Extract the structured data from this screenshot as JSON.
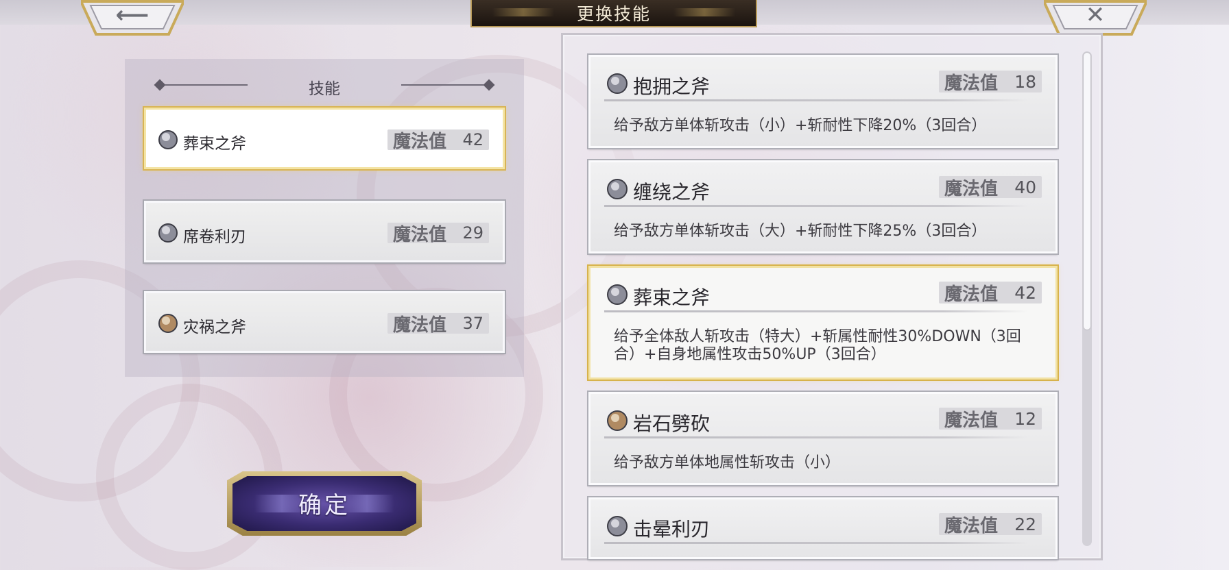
{
  "title": "更换技能",
  "nav": {
    "back_icon": "back-arrow-icon",
    "close_icon": "close-icon"
  },
  "equipped": {
    "heading": "技能",
    "slots": [
      {
        "name": "葬束之斧",
        "mp_label": "魔法值",
        "mp": "42",
        "orb": "silver",
        "selected": true
      },
      {
        "name": "席卷利刃",
        "mp_label": "魔法值",
        "mp": "29",
        "orb": "silver",
        "selected": false
      },
      {
        "name": "灾祸之斧",
        "mp_label": "魔法值",
        "mp": "37",
        "orb": "bronze",
        "selected": false
      }
    ]
  },
  "confirm_label": "确定",
  "skills": [
    {
      "name": "抱拥之斧",
      "mp_label": "魔法值",
      "mp": "18",
      "orb": "silver",
      "selected": false,
      "desc": "给予敌方单体斩攻击（小）+斩耐性下降20%（3回合）"
    },
    {
      "name": "缠绕之斧",
      "mp_label": "魔法值",
      "mp": "40",
      "orb": "silver",
      "selected": false,
      "desc": "给予敌方单体斩攻击（大）+斩耐性下降25%（3回合）"
    },
    {
      "name": "葬束之斧",
      "mp_label": "魔法值",
      "mp": "42",
      "orb": "silver",
      "selected": true,
      "desc": "给予全体敌人斩攻击（特大）+斩属性耐性30%DOWN（3回合）+自身地属性攻击50%UP（3回合）"
    },
    {
      "name": "岩石劈砍",
      "mp_label": "魔法值",
      "mp": "12",
      "orb": "bronze",
      "selected": false,
      "desc": "给予敌方单体地属性斩攻击（小）"
    },
    {
      "name": "击晕利刃",
      "mp_label": "魔法值",
      "mp": "22",
      "orb": "silver",
      "selected": false,
      "desc": ""
    }
  ],
  "colors": {
    "selected_border": "#d8b454",
    "title_plate": "#2a2019",
    "confirm_button": "#3a2c72",
    "orb_silver": "#8c8d99",
    "orb_bronze": "#b08a62"
  }
}
